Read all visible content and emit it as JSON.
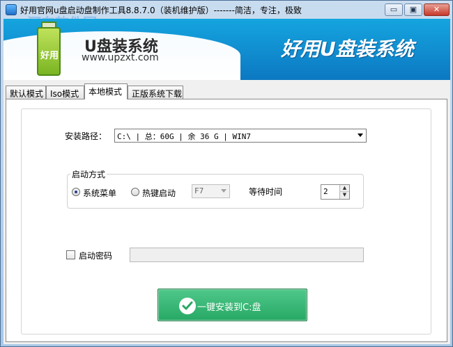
{
  "window": {
    "title": "好用官网u盘启动盘制作工具8.8.7.0（装机维护版）-------简洁，专注，极致",
    "watermark": "河东软件园",
    "controls": {
      "minimize": "▭",
      "maximize": "▣",
      "close": "✕"
    }
  },
  "banner": {
    "logo_text": "好用",
    "brand_name": "U盘装系统",
    "brand_url": "www.upzxt.com",
    "slogan": "好用U盘装系统"
  },
  "tabs": [
    {
      "label": "默认模式"
    },
    {
      "label": "Iso模式"
    },
    {
      "label": "本地模式"
    },
    {
      "label": "正版系统下载"
    }
  ],
  "active_tab": "本地模式",
  "install_path": {
    "label": "安装路径：",
    "value": "C:\\ | 总：60G | 余 36 G | WIN7"
  },
  "boot_mode": {
    "legend": "启动方式",
    "option_menu": "系统菜单",
    "option_hotkey": "热键启动",
    "selected": "系统菜单",
    "hotkey_value": "F7",
    "wait_label": "等待时间",
    "wait_value": "2"
  },
  "boot_password": {
    "label": "启动密码",
    "checked": false,
    "value": ""
  },
  "install_button": {
    "label": "一键安装到C:盘"
  },
  "colors": {
    "banner_blue": "#0c78c2",
    "install_green": "#27a864"
  }
}
